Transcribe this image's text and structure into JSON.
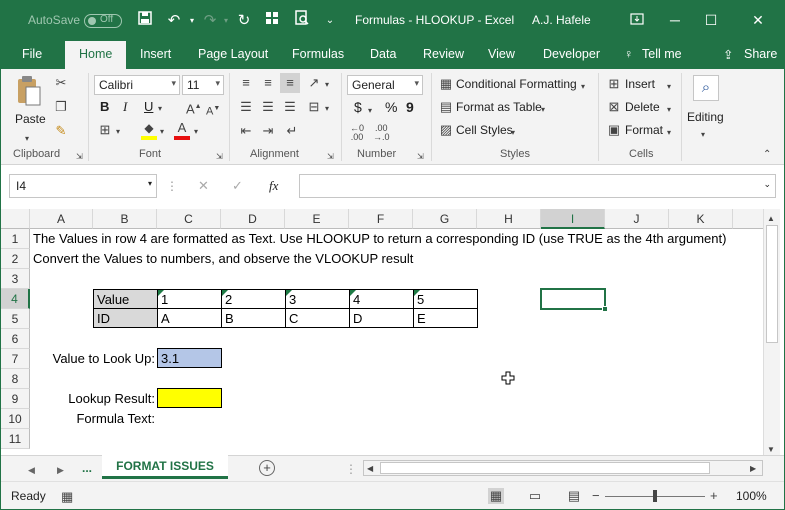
{
  "titlebar": {
    "autosave_label": "AutoSave",
    "autosave_state": "Off",
    "doc_title": "Formulas - HLOOKUP  -  Excel",
    "user": "A.J. Hafele"
  },
  "tabs": [
    "File",
    "Home",
    "Insert",
    "Page Layout",
    "Formulas",
    "Data",
    "Review",
    "Developer",
    "Tell me",
    "Share"
  ],
  "ribbon": {
    "clipboard": {
      "paste": "Paste",
      "group": "Clipboard"
    },
    "font": {
      "name": "Calibri",
      "size": "11",
      "bold": "B",
      "italic": "I",
      "underline": "U",
      "font_color": "A",
      "group": "Font"
    },
    "alignment": {
      "group": "Alignment"
    },
    "number": {
      "format": "General",
      "currency": "$",
      "percent": "%",
      "comma": "9",
      "inc_decimal": ".00→.0",
      "group": "Number"
    },
    "styles": {
      "conditional": "Conditional Formatting",
      "table": "Format as Table",
      "cell_styles": "Cell Styles",
      "group": "Styles"
    },
    "cells": {
      "insert": "Insert",
      "delete": "Delete",
      "format": "Format",
      "group": "Cells"
    },
    "editing": {
      "label": "Editing"
    }
  },
  "formula_bar": {
    "name_box": "I4",
    "fx": "fx",
    "formula": ""
  },
  "columns": [
    "A",
    "B",
    "C",
    "D",
    "E",
    "F",
    "G",
    "H",
    "I",
    "J",
    "K"
  ],
  "rows": [
    "1",
    "2",
    "3",
    "4",
    "5",
    "6",
    "7",
    "8",
    "9",
    "10",
    "11"
  ],
  "cells": {
    "A1": "The Values in row 4 are formatted as Text.  Use HLOOKUP to return a corresponding ID (use TRUE as the 4th argument)",
    "A2": "Convert the Values to numbers, and observe the VLOOKUP result",
    "B4": "Value",
    "C4": "1",
    "D4": "2",
    "E4": "3",
    "F4": "4",
    "G4": "5",
    "B5": "ID",
    "C5": "A",
    "D5": "B",
    "E5": "C",
    "F5": "D",
    "G5": "E",
    "B7": "Value to Look Up:",
    "C7": "3.1",
    "B9": "Lookup Result:",
    "B10": "Formula Text:"
  },
  "sheet_tabs": {
    "ellipsis": "...",
    "active": "FORMAT ISSUES"
  },
  "status": {
    "ready": "Ready",
    "zoom": "100%"
  },
  "colors": {
    "accent": "#217346",
    "lookup_value_fill": "#b4c6e7",
    "result_fill": "#ffff00",
    "header_fill": "#d9d9d9"
  }
}
